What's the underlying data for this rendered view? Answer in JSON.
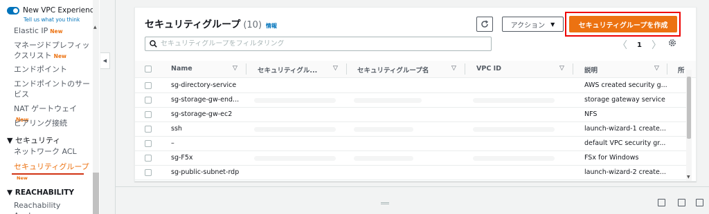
{
  "sidebar": {
    "vpc_experience_label": "New VPC Experience",
    "vpc_feedback_link": "Tell us what you think",
    "new_badge": "New",
    "items": {
      "elastic_ip": "Elastic IP",
      "managed_prefix_list": "マネージドプレフィックスリスト",
      "endpoints": "エンドポイント",
      "endpoint_services": "エンドポイントのサービス",
      "nat_gateway": "NAT ゲートウェイ",
      "peering": "ピアリング接続"
    },
    "security_section": "▼ セキュリティ",
    "security_items": {
      "network_acl": "ネットワーク ACL",
      "security_groups": "セキュリティグループ"
    },
    "reachability_section": "▼ REACHABILITY",
    "reachability_analyzer": "Reachability Analyzer"
  },
  "panel": {
    "title": "セキュリティグループ",
    "count": "(10)",
    "info_link": "情報",
    "action_button": "アクション",
    "create_button": "セキュリティグループを作成",
    "filter_placeholder": "セキュリティグループをフィルタリング",
    "page_number": "1"
  },
  "table": {
    "columns": [
      "Name",
      "セキュリティグル...",
      "セキュリティグループ名",
      "VPC ID",
      "説明",
      "所"
    ],
    "rows": [
      {
        "name": "sg-directory-service",
        "description": "AWS created security g..."
      },
      {
        "name": "sg-storage-gw-end...",
        "description": "storage gateway service"
      },
      {
        "name": "sg-storage-gw-ec2",
        "description": "NFS"
      },
      {
        "name": "ssh",
        "description": "launch-wizard-1 create..."
      },
      {
        "name": "–",
        "description": "default VPC security gr..."
      },
      {
        "name": "sg-F5x",
        "description": "FSx for Windows"
      },
      {
        "name": "sg-public-subnet-rdp",
        "description": "launch-wizard-2 create..."
      }
    ]
  },
  "colors": {
    "accent_orange": "#ec7211",
    "link_blue": "#0073bb",
    "highlight_red": "#ee0000"
  },
  "icons": [
    "toggle-icon",
    "refresh-icon",
    "caret-down-icon",
    "search-icon",
    "chevron-left-icon",
    "chevron-right-icon",
    "settings-gear-icon",
    "sort-icon",
    "layout-icon"
  ]
}
